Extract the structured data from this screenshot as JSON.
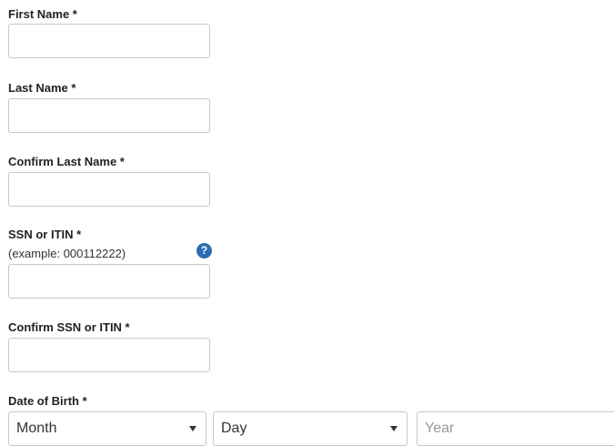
{
  "form": {
    "first_name": {
      "label": "First Name *",
      "value": "",
      "placeholder": ""
    },
    "last_name": {
      "label": "Last Name *",
      "value": "",
      "placeholder": ""
    },
    "confirm_last_name": {
      "label": "Confirm Last Name *",
      "value": "",
      "placeholder": ""
    },
    "ssn": {
      "label": "SSN or ITIN *",
      "hint": "(example: 000112222)",
      "value": "",
      "placeholder": "",
      "help_icon": "question-circle-icon",
      "help_glyph": "?"
    },
    "confirm_ssn": {
      "label": "Confirm SSN or ITIN *",
      "value": "",
      "placeholder": ""
    },
    "dob": {
      "label": "Date of Birth *",
      "month": {
        "selected": "Month",
        "icon": "chevron-down-icon"
      },
      "day": {
        "selected": "Day",
        "icon": "chevron-down-icon"
      },
      "year": {
        "placeholder": "Year"
      }
    }
  },
  "colors": {
    "help_icon": "#2c6db2",
    "border": "#c8c8c8",
    "label": "#222222"
  }
}
